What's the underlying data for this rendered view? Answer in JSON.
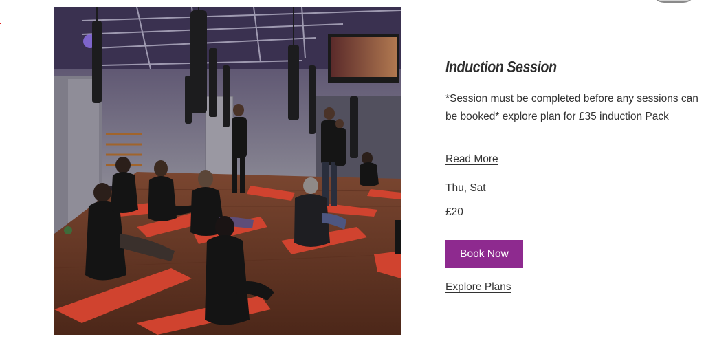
{
  "card": {
    "title": "Induction Session",
    "description": "*Session must be completed before any sessions can be booked* explore plan for £35 induction Pack",
    "read_more_label": "Read More",
    "days": "Thu, Sat",
    "price": "£20",
    "book_button_label": "Book Now",
    "explore_plans_label": "Explore Plans"
  },
  "photo": {
    "subject": "group fitness class seated on red mats in studio with suspension straps"
  },
  "colors": {
    "accent": "#8e2a8f",
    "text": "#333333",
    "mat": "#d0432f",
    "floor": "#6b3a28"
  }
}
